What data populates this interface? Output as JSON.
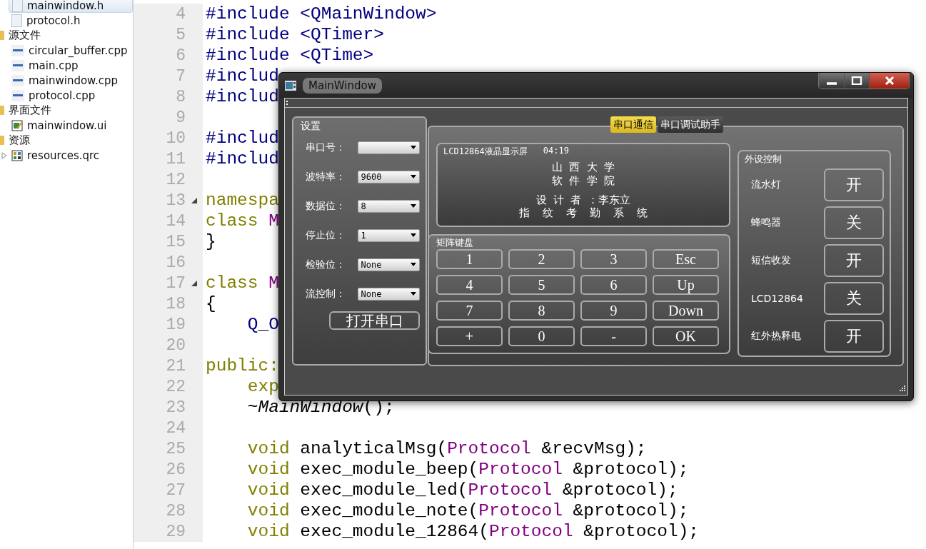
{
  "sidebar": {
    "items": [
      {
        "label": "mainwindow.h",
        "kind": "header",
        "selected": true
      },
      {
        "label": "protocol.h",
        "kind": "header",
        "selected": false
      },
      {
        "label": "源文件",
        "kind": "sources",
        "expanded": true,
        "selected": false,
        "children": [
          {
            "label": "circular_buffer.cpp",
            "kind": "cpp",
            "selected": false
          },
          {
            "label": "main.cpp",
            "kind": "cpp",
            "selected": false
          },
          {
            "label": "mainwindow.cpp",
            "kind": "cpp",
            "selected": false
          },
          {
            "label": "protocol.cpp",
            "kind": "cpp",
            "selected": false
          }
        ]
      },
      {
        "label": "界面文件",
        "kind": "forms",
        "expanded": true,
        "selected": false,
        "children": [
          {
            "label": "mainwindow.ui",
            "kind": "ui",
            "selected": false
          }
        ]
      },
      {
        "label": "资源",
        "kind": "resources",
        "expanded": true,
        "selected": false,
        "children": [
          {
            "label": "resources.qrc",
            "kind": "qrc",
            "expanded": false,
            "selected": false
          }
        ]
      }
    ]
  },
  "editor": {
    "lines": [
      {
        "number": "4",
        "fold": false,
        "tokens": [
          {
            "text": "#include <QMainWindow>",
            "kind": "preprocessor"
          }
        ]
      },
      {
        "number": "5",
        "fold": false,
        "tokens": [
          {
            "text": "#include <QTimer>",
            "kind": "preprocessor"
          }
        ]
      },
      {
        "number": "6",
        "fold": false,
        "tokens": [
          {
            "text": "#include <QTime>",
            "kind": "preprocessor"
          }
        ]
      },
      {
        "number": "7",
        "fold": false,
        "tokens": [
          {
            "text": "#includ",
            "kind": "preprocessor"
          }
        ]
      },
      {
        "number": "8",
        "fold": false,
        "tokens": [
          {
            "text": "#includ",
            "kind": "preprocessor"
          }
        ]
      },
      {
        "number": "9",
        "fold": false
      },
      {
        "number": "10",
        "fold": false,
        "tokens": [
          {
            "text": "#includ",
            "kind": "preprocessor"
          }
        ]
      },
      {
        "number": "11",
        "fold": false,
        "tokens": [
          {
            "text": "#includ",
            "kind": "preprocessor"
          }
        ]
      },
      {
        "number": "12",
        "fold": false
      },
      {
        "number": "13",
        "fold": true,
        "tokens": [
          {
            "text": "namespa",
            "kind": "keyword"
          }
        ]
      },
      {
        "number": "14",
        "fold": false,
        "tokens": [
          {
            "text": "class",
            "kind": "keyword"
          },
          {
            "text": " M",
            "kind": "type"
          }
        ]
      },
      {
        "number": "15",
        "fold": false,
        "tokens": [
          {
            "text": "}",
            "kind": "plain"
          }
        ]
      },
      {
        "number": "16",
        "fold": false
      },
      {
        "number": "17",
        "fold": true,
        "tokens": [
          {
            "text": "class",
            "kind": "keyword"
          },
          {
            "text": " M",
            "kind": "type"
          }
        ]
      },
      {
        "number": "18",
        "fold": false,
        "tokens": [
          {
            "text": "{",
            "kind": "plain"
          }
        ]
      },
      {
        "number": "19",
        "fold": false,
        "tokens": [
          {
            "text": "    Q_O",
            "kind": "preprocessor"
          }
        ]
      },
      {
        "number": "20",
        "fold": false
      },
      {
        "number": "21",
        "fold": false,
        "tokens": [
          {
            "text": "public:",
            "kind": "keyword"
          }
        ]
      },
      {
        "number": "22",
        "fold": false,
        "tokens": [
          {
            "text": "    exp",
            "kind": "keyword"
          }
        ]
      },
      {
        "number": "23",
        "fold": false,
        "tokens": [
          {
            "text": "    ~",
            "kind": "plain"
          },
          {
            "text": "MainWindow",
            "kind": "italic"
          },
          {
            "text": "();",
            "kind": "plain"
          }
        ]
      },
      {
        "number": "24",
        "fold": false
      },
      {
        "number": "25",
        "fold": false,
        "tokens": [
          {
            "text": "    void",
            "kind": "keyword"
          },
          {
            "text": " analyticalMsg(",
            "kind": "plain"
          },
          {
            "text": "Protocol",
            "kind": "type"
          },
          {
            "text": " &recvMsg);",
            "kind": "plain"
          }
        ]
      },
      {
        "number": "26",
        "fold": false,
        "tokens": [
          {
            "text": "    void",
            "kind": "keyword"
          },
          {
            "text": " exec_module_beep(",
            "kind": "plain"
          },
          {
            "text": "Protocol",
            "kind": "type"
          },
          {
            "text": " &protocol);",
            "kind": "plain"
          }
        ]
      },
      {
        "number": "27",
        "fold": false,
        "tokens": [
          {
            "text": "    void",
            "kind": "keyword"
          },
          {
            "text": " exec_module_led(",
            "kind": "plain"
          },
          {
            "text": "Protocol",
            "kind": "type"
          },
          {
            "text": " &protocol);",
            "kind": "plain"
          }
        ]
      },
      {
        "number": "28",
        "fold": false,
        "tokens": [
          {
            "text": "    void",
            "kind": "keyword"
          },
          {
            "text": " exec_module_note(",
            "kind": "plain"
          },
          {
            "text": "Protocol",
            "kind": "type"
          },
          {
            "text": " &protocol);",
            "kind": "plain"
          }
        ]
      },
      {
        "number": "29",
        "fold": false,
        "tokens": [
          {
            "text": "    void",
            "kind": "keyword"
          },
          {
            "text": " exec_module_12864(",
            "kind": "plain"
          },
          {
            "text": "Protocol",
            "kind": "type"
          },
          {
            "text": " &protocol);",
            "kind": "plain"
          }
        ]
      }
    ]
  },
  "window": {
    "title": "MainWindow",
    "settings": {
      "title": "设置",
      "fields": [
        {
          "label": "串口号："
        },
        {
          "label": "波特率：",
          "value": "9600"
        },
        {
          "label": "数据位：",
          "value": "8"
        },
        {
          "label": "停止位：",
          "value": "1"
        },
        {
          "label": "检验位：",
          "value": "None"
        },
        {
          "label": "流控制：",
          "value": "None"
        }
      ],
      "button": "打开串口"
    },
    "tabs": [
      {
        "label": "串口通信",
        "selected": true
      },
      {
        "label": "串口调试助手",
        "selected": false
      }
    ],
    "lcd": {
      "title": "LCD12864液晶显示屏",
      "time": "04:19",
      "lines": [
        "山 西 大 学",
        "软 件 学 院",
        "设 计 者 ：李东立",
        "指  纹  考  勤  系  统"
      ]
    },
    "keypad": {
      "title": "矩阵键盘",
      "keys": [
        "1",
        "2",
        "3",
        "Esc",
        "4",
        "5",
        "6",
        "Up",
        "7",
        "8",
        "9",
        "Down",
        "+",
        "0",
        "-",
        "OK"
      ]
    },
    "peripherals": {
      "title": "外设控制",
      "rows": [
        {
          "label": "流水灯",
          "button": "开"
        },
        {
          "label": "蜂鸣器",
          "button": "关"
        },
        {
          "label": "短信收发",
          "button": "开"
        },
        {
          "label": "LCD12864",
          "button": "关"
        },
        {
          "label": "红外热释电",
          "button": "开"
        }
      ]
    }
  }
}
